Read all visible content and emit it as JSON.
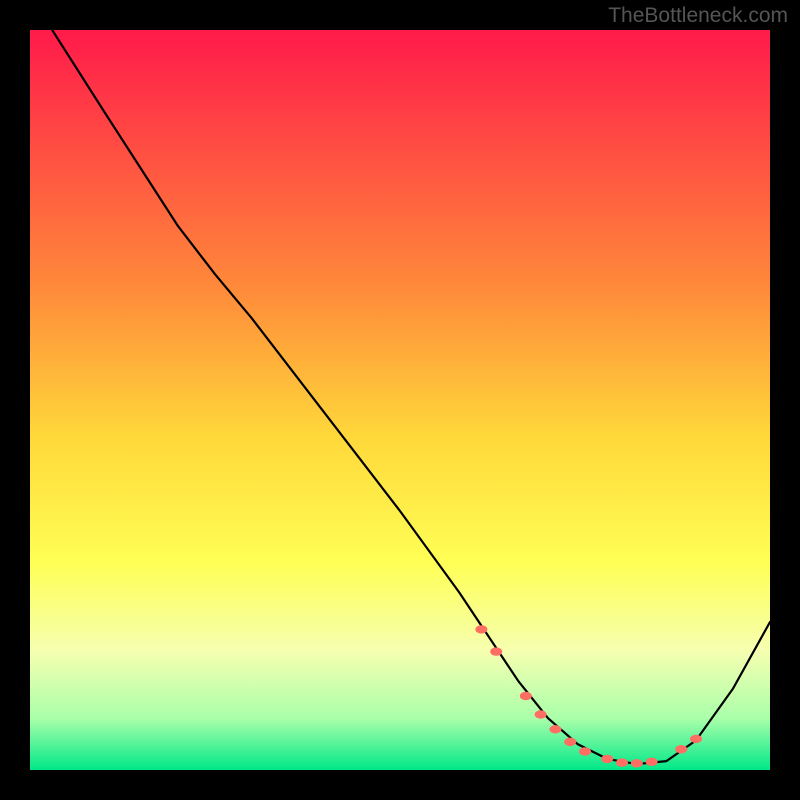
{
  "watermark": "TheBottleneck.com",
  "chart_data": {
    "type": "line",
    "title": "",
    "xlabel": "",
    "ylabel": "",
    "xlim": [
      0,
      100
    ],
    "ylim": [
      0,
      100
    ],
    "gradient_stops": [
      {
        "offset": 0,
        "color": "#ff1a4a"
      },
      {
        "offset": 35,
        "color": "#ff8a3a"
      },
      {
        "offset": 55,
        "color": "#ffd83a"
      },
      {
        "offset": 72,
        "color": "#ffff55"
      },
      {
        "offset": 84,
        "color": "#f5ffb0"
      },
      {
        "offset": 93,
        "color": "#aaffaa"
      },
      {
        "offset": 100,
        "color": "#00e888"
      }
    ],
    "series": [
      {
        "name": "bottleneck-curve",
        "x": [
          3,
          10,
          20,
          25,
          30,
          40,
          50,
          58,
          62,
          66,
          70,
          74,
          78,
          82,
          86,
          90,
          95,
          100
        ],
        "y": [
          100,
          89,
          73.5,
          67,
          61,
          48,
          35,
          24,
          18,
          12,
          7,
          3.5,
          1.5,
          0.8,
          1.2,
          4,
          11,
          20
        ]
      }
    ],
    "markers": {
      "name": "highlight-points",
      "x": [
        61,
        63,
        67,
        69,
        71,
        73,
        75,
        78,
        80,
        82,
        84,
        88,
        90
      ],
      "y": [
        19,
        16,
        10,
        7.5,
        5.5,
        3.8,
        2.5,
        1.5,
        1.0,
        0.9,
        1.1,
        2.8,
        4.2
      ],
      "color": "#ff6e63",
      "rx": 6,
      "ry": 4.2
    }
  }
}
